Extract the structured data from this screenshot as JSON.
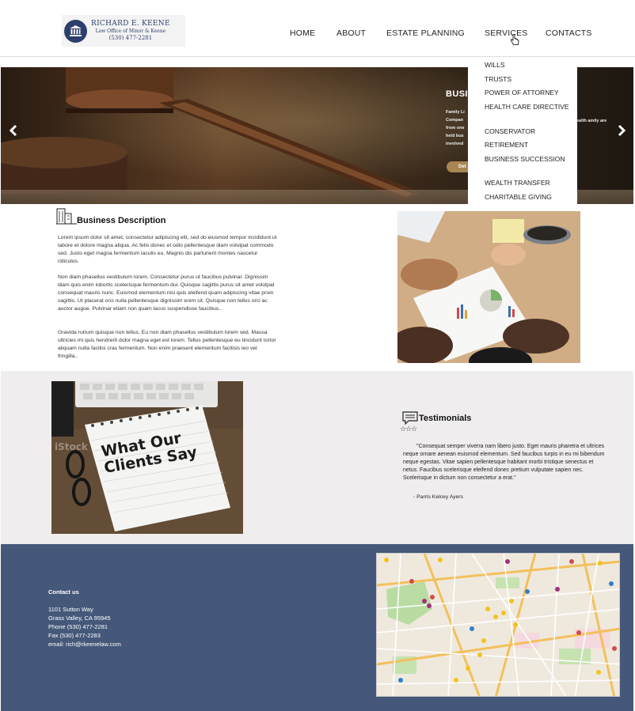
{
  "brand": {
    "name": "RICHARD E. KEENE",
    "subtitle": "Law Office of Minor & Keene",
    "phone": "(530) 477-2281"
  },
  "nav": {
    "items": [
      "HOME",
      "ABOUT",
      "ESTATE PLANNING",
      "SERVICES",
      "CONTACTS"
    ]
  },
  "services_menu": {
    "items": [
      "WILLS",
      "TRUSTS",
      "POWER OF ATTORNEY",
      "HEALTH CARE DIRECTIVE",
      "CONSERVATOR",
      "RETIREMENT",
      "BUSINESS SUCCESSION",
      "WEALTH TRANSFER",
      "CHARITABLE GIVING"
    ]
  },
  "hero": {
    "title": "BUSI",
    "text_left": "Family Li Compan from one held bus involved",
    "text_right": "ealth amily are",
    "button_label": "Det"
  },
  "business": {
    "title": "Business Description",
    "paragraphs": [
      "Lorem ipsum dolor sit amet, consectetur adipiscing elit, sed do eiusmod tempor incididunt ut labore et dolore magna aliqua. Ac felis donec et odio pellentesque diam volutpat commodo sed. Justo eget magna fermentum iaculis eu. Magnis dis parturient montes nascetur ridiculus.",
      "Non diam phasellus vestibulum lorem. Consectetur purus ut faucibus pulvinar. Dignissim diam quis enim lobortis scelerisque fermentum dui. Quisque sagittis purus sit amet volutpat consequat mauris nunc. Euismod elementum nisi quis eleifend quam adipiscing vitae proin sagittis. Ut placerat orci nulla pellentesque dignissim enim sit. Quisque non tellus orci ac auctor augue. Pulvinar etiam non quam lacus suspendisse faucibus..",
      "Gravida rutrum quisque non tellus. Eu non diam phasellus vestibulum lorem sed. Massa ultricies mi quis hendrerit dolor magna eget est lorem. Tellus pellentesque eu tincidunt tortor aliquam nulla facilisi cras fermentum. Non enim praesent elementum facilisis leo vel fringilla.."
    ]
  },
  "testimonials": {
    "image_text": "What Our Clients Say",
    "watermark": "iStock",
    "title": "Testimonials",
    "stars": "☆☆☆",
    "quote": "\"Consequat semper viverra nam libero justo. Eget mauris pharetra et ultrices neque ornare aenean euismod elementum. Sed faucibus turpis in eu mi bibendum neque egestas. Vitae sapien pellentesque habitant morbi tristique senectus et netus. Faucibus scelerisque eleifend donec pretium vulputate sapien nec. Scelerisque in dictum non consectetur a erat.\"",
    "author": "- Parris Kelcey Ayers"
  },
  "contact": {
    "title": "Contact us",
    "lines": [
      "1101 Sutton Way",
      "Grass Valley, CA 95945",
      "Phone (530) 477-2281",
      "Fax  (530) 477-2283",
      "email: rich@rkeenelaw.com"
    ]
  },
  "colors": {
    "footer_bg": "#45587a",
    "testimonials_bg": "#efeded",
    "hero_button": "#a88552",
    "logo_navy": "#2c3e6b"
  },
  "icons": {
    "logo": "courthouse-seal-icon",
    "cursor": "hand-pointer-icon",
    "hero_prev": "chevron-left-icon",
    "hero_next": "chevron-right-icon",
    "business": "building-icon",
    "testimonials": "chat-bubble-icon"
  }
}
